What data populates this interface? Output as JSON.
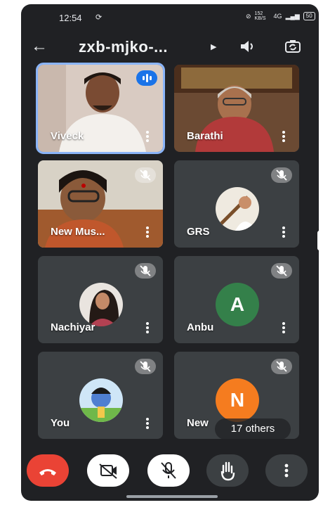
{
  "status_bar": {
    "time": "12:54",
    "speed": "152 KB/S",
    "network": "4G",
    "battery": "50"
  },
  "meeting": {
    "title": "zxb-mjko-..."
  },
  "icons": {
    "back": "arrow-left-icon",
    "dropdown": "caret-right-icon",
    "speaker": "volume-icon",
    "switch_camera": "camera-switch-icon",
    "more": "more-vert-icon",
    "mic_off": "mic-off-icon",
    "speaking": "audio-wave-icon",
    "hand": "raise-hand-icon",
    "end_call": "phone-hangup-icon",
    "camera_off": "video-off-icon"
  },
  "participants": [
    {
      "name": "Viveck",
      "state": "speaking"
    },
    {
      "name": "Barathi",
      "state": "video"
    },
    {
      "name": "New Mus...",
      "state": "muted"
    },
    {
      "name": "GRS",
      "state": "muted"
    },
    {
      "name": "Nachiyar",
      "state": "muted"
    },
    {
      "name": "Anbu",
      "state": "muted",
      "initial": "A",
      "avatar_color": "#34804a"
    },
    {
      "name": "You",
      "state": "muted"
    },
    {
      "name": "New",
      "state": "muted",
      "initial": "N",
      "avatar_color": "#f57c1f"
    }
  ],
  "others_chip": "17 others",
  "colors": {
    "background": "#202124",
    "tile": "#3c4043",
    "end_call": "#ea4335",
    "active_outline": "#8ab4f8",
    "speaking_badge": "#1a73e8"
  }
}
